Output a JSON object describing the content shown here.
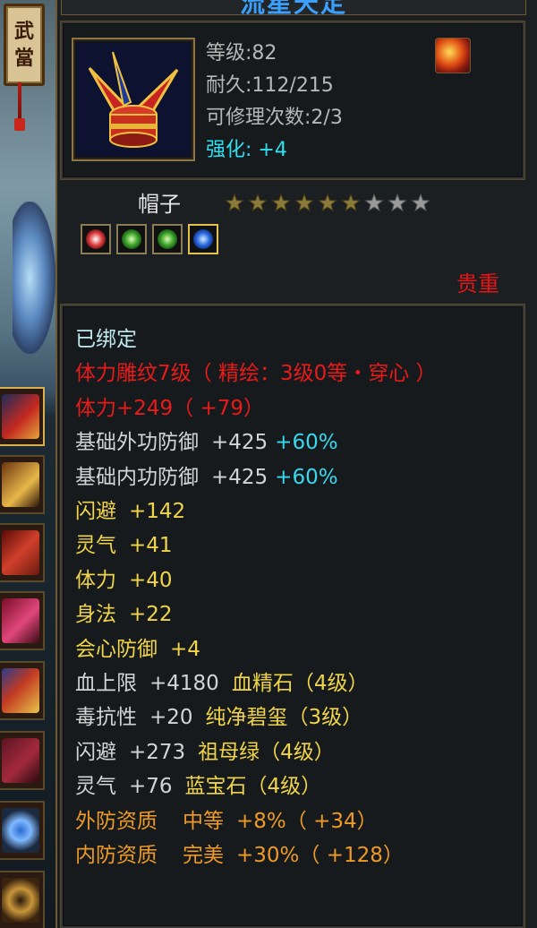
{
  "window": {
    "title": "流星天定"
  },
  "left_strip": {
    "sign_chars": [
      "武",
      "當"
    ],
    "slots": [
      {
        "name": "hat-slot",
        "active": true
      },
      {
        "name": "shoulder-slot",
        "active": false
      },
      {
        "name": "bracer-slot",
        "active": false
      },
      {
        "name": "glove-slot",
        "active": false
      },
      {
        "name": "belt-slot",
        "active": false
      },
      {
        "name": "boot-slot",
        "active": false
      },
      {
        "name": "ring-slot",
        "active": false
      },
      {
        "name": "ring2-slot",
        "active": false
      }
    ]
  },
  "item": {
    "level": "等级:82",
    "durability": "耐久:112/215",
    "repairs": "可修理次数:2/3",
    "enhance": "强化: +4",
    "name": "帽子",
    "stars_filled": 6,
    "stars_total": 9,
    "rarity": "贵重",
    "gems": [
      "red-rune-gem",
      "green-jade-gem",
      "green-jade-gem-2",
      "blue-sapphire-gem"
    ]
  },
  "properties": {
    "bound": "已绑定",
    "engrave": "体力雕纹7级（ 精绘：3级0等・穿心 ）",
    "stamina_total": "体力+249（ +79）",
    "ext_def": {
      "label": "基础外功防御",
      "value": "+425",
      "pct": "+60%"
    },
    "int_def": {
      "label": "基础内功防御",
      "value": "+425",
      "pct": "+60%"
    },
    "dodge": {
      "label": "闪避",
      "value": "+142"
    },
    "spirit": {
      "label": "灵气",
      "value": "+41"
    },
    "stamina": {
      "label": "体力",
      "value": "+40"
    },
    "agility": {
      "label": "身法",
      "value": "+22"
    },
    "crit_def": {
      "label": "会心防御",
      "value": "+4"
    },
    "hp": {
      "label": "血上限",
      "value": "+4180",
      "gem": "血精石（4级）"
    },
    "poison": {
      "label": "毒抗性",
      "value": "+20",
      "gem": "纯净碧玺（3级）"
    },
    "dodge_gem": {
      "label": "闪避",
      "value": "+273",
      "gem": "祖母绿（4级）"
    },
    "spirit_gem": {
      "label": "灵气",
      "value": "+76",
      "gem": "蓝宝石（4级）"
    },
    "ext_quality": {
      "label": "外防资质",
      "grade": "中等",
      "pct": "+8%",
      "bonus": "（ +34）"
    },
    "int_quality": {
      "label": "内防资质",
      "grade": "完美",
      "pct": "+30%",
      "bonus": "（ +128）"
    }
  },
  "colors": {
    "panel_border": "#6d5a34",
    "enhance": "#2fe0f0",
    "rarity": "#e21616",
    "attribute": "#f0d44a",
    "percent": "#38d8ee",
    "quality": "#ee9a26"
  }
}
